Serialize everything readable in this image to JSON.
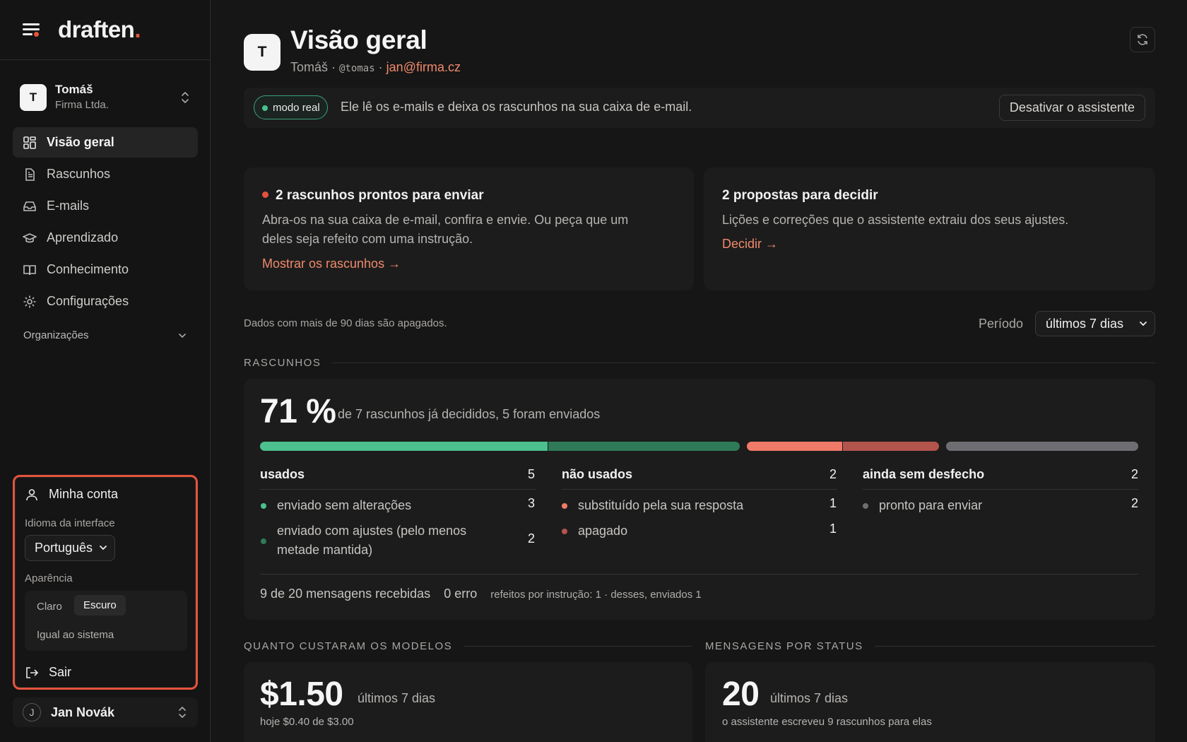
{
  "app": {
    "logo_text": "draften",
    "logo_dot": "."
  },
  "account": {
    "initial": "T",
    "name": "Tomáš",
    "org": "Firma Ltda."
  },
  "nav": [
    {
      "label": "Visão geral",
      "icon": "dashboard-icon",
      "active": true
    },
    {
      "label": "Rascunhos",
      "icon": "document-icon"
    },
    {
      "label": "E-mails",
      "icon": "inbox-icon"
    },
    {
      "label": "Aprendizado",
      "icon": "graduation-cap-icon"
    },
    {
      "label": "Conhecimento",
      "icon": "book-icon"
    },
    {
      "label": "Configurações",
      "icon": "gear-icon"
    }
  ],
  "orgs_label": "Organizações",
  "account_menu": {
    "my_account": "Minha conta",
    "language_label": "Idioma da interface",
    "language_value": "Português",
    "appearance_label": "Aparência",
    "theme_light": "Claro",
    "theme_dark": "Escuro",
    "theme_system": "Igual ao sistema",
    "logout": "Sair"
  },
  "user": {
    "initial": "J",
    "name": "Jan Novák"
  },
  "header": {
    "initial": "T",
    "title": "Visão geral",
    "name": "Tomáš",
    "sep1": "·",
    "handle": "@tomas",
    "sep2": "·",
    "email": "jan@firma.cz"
  },
  "mode": {
    "pill": "modo real",
    "text": "Ele lê os e-mails e deixa os rascunhos na sua caixa de e-mail.",
    "deactivate": "Desativar o assistente"
  },
  "cards": {
    "drafts_title": "2 rascunhos prontos para enviar",
    "drafts_text": "Abra-os na sua caixa de e-mail, confira e envie. Ou peça que um deles seja refeito com uma instrução.",
    "drafts_link": "Mostrar os rascunhos →",
    "proposals_title": "2 propostas para decidir",
    "proposals_text": "Lições e correções que o assistente extraiu dos seus ajustes.",
    "proposals_link": "Decidir →"
  },
  "retention": "Dados com mais de 90 dias são apagados.",
  "period": {
    "label": "Período",
    "value": "últimos 7 dias"
  },
  "drafts_section": {
    "title": "RASCUNHOS",
    "percent": "71 %",
    "percent_text": "de 7 rascunhos já decididos, 5 foram enviados",
    "bar_fractions": {
      "sent_unchanged": 0.3,
      "sent_adjusted": 0.2,
      "replaced": 0.1,
      "deleted": 0.1,
      "pending": 0.2
    },
    "used": {
      "label": "usados",
      "count": "5",
      "rows": [
        {
          "label": "enviado sem alterações",
          "count": "3"
        },
        {
          "label": "enviado com ajustes (pelo menos metade mantida)",
          "count": "2"
        }
      ]
    },
    "unused": {
      "label": "não usados",
      "count": "2",
      "rows": [
        {
          "label": "substituído pela sua resposta",
          "count": "1"
        },
        {
          "label": "apagado",
          "count": "1"
        }
      ]
    },
    "pending": {
      "label": "ainda sem desfecho",
      "count": "2",
      "rows": [
        {
          "label": "pronto para enviar",
          "count": "2"
        }
      ]
    },
    "footer_received_num": "9",
    "footer_received": "de 20 mensagens recebidas",
    "footer_errors": "0 erro",
    "footer_redo": "refeitos por instrução: 1 · desses, enviados 1"
  },
  "costs": {
    "title": "QUANTO CUSTARAM OS MODELOS",
    "value": "$1.50",
    "period": "últimos 7 dias",
    "today": "hoje $0.40 de $3.00"
  },
  "messages": {
    "title": "MENSAGENS POR STATUS",
    "value": "20",
    "period": "últimos 7 dias",
    "sub": "o assistente escreveu 9 rascunhos para elas"
  },
  "colors": {
    "accent": "#e5533d",
    "green": "#4cc08e",
    "green_dark": "#2f7a58",
    "salmon": "#f07a68",
    "rose": "#b3544d",
    "grey": "#6e6e72"
  }
}
